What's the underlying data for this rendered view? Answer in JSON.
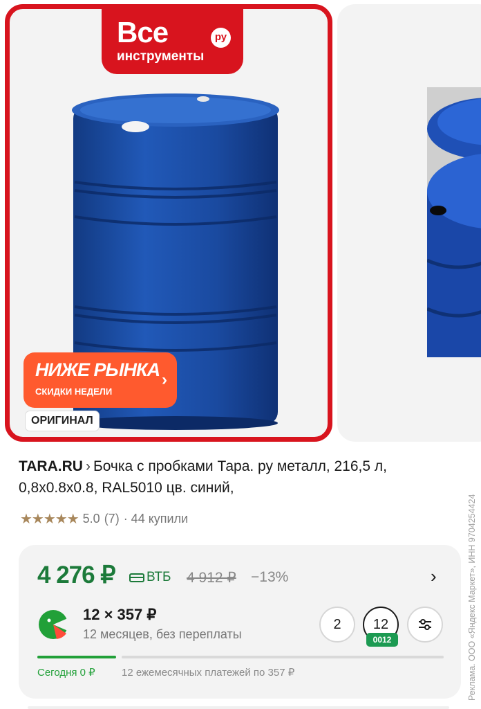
{
  "gallery": {
    "brand": {
      "line1": "Все",
      "line2": "инструменты",
      "ru": "ру"
    },
    "promo": {
      "title": "НИЖЕ РЫНКА",
      "subtitle": "СКИДКИ НЕДЕЛИ",
      "arrow": "›"
    },
    "original_badge": "ОРИГИНАЛ",
    "barrel_color": "#1d4ea3",
    "frame_color": "#d8141e"
  },
  "product": {
    "shop": "TARA.RU",
    "chevron": "›",
    "title": "Бочка с пробками Тара. ру металл, 216,5 л, 0,8x0.8x0.8, RAL5010 цв. синий,",
    "stars": "★★★★★",
    "rating": "5.0",
    "reviews": "(7)",
    "purchases": "· 44 купили"
  },
  "price": {
    "current": "4 276 ₽",
    "bank": "ВТБ",
    "old": "4 912 ₽",
    "discount": "−13%",
    "chevron": "›",
    "accent": "#1c7a3a"
  },
  "installments": {
    "amount": "12 × 357 ₽",
    "terms": "12 месяцев, без переплаты",
    "options": [
      "2",
      "12"
    ],
    "selected": "12",
    "badge": "0012",
    "settings_icon": "sliders-icon",
    "progress": 0.2,
    "today": "Сегодня 0 ₽",
    "monthly": "12 ежемесячных платежей по 357 ₽"
  },
  "ad_notice": "Реклама. ООО «Яндекс Маркет», ИНН 9704254424"
}
